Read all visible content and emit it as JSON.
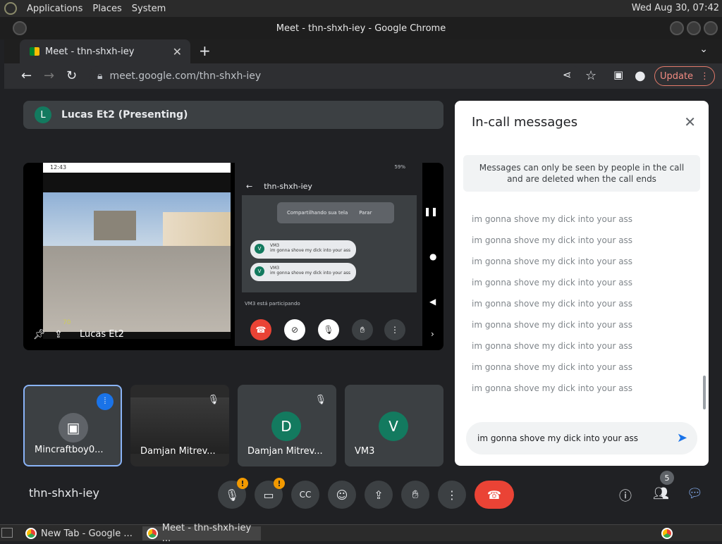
{
  "os": {
    "menu": [
      "Applications",
      "Places",
      "System"
    ],
    "clock": "Wed Aug 30, 07:42"
  },
  "window": {
    "title": "Meet - thn-shxh-iey - Google Chrome"
  },
  "tab": {
    "label": "Meet - thn-shxh-iey"
  },
  "nav": {
    "url": "meet.google.com/thn-shxh-iey",
    "update_label": "Update"
  },
  "presenting": {
    "initial": "L",
    "label": "Lucas Et2 (Presenting)"
  },
  "main_video": {
    "presenter": "Lucas Et2",
    "left_status": "12:43",
    "hud_value": "70",
    "right_status": "59%",
    "screen_header": "thn-shxh-iey",
    "toast_text": "Compartilhando sua tela",
    "toast_action": "Parar",
    "inner_messages": [
      {
        "initial": "V",
        "sender": "VM3",
        "text": "im gonna shove my dick into your ass"
      },
      {
        "initial": "V",
        "sender": "VM3",
        "text": "im gonna shove my dick into your ass"
      }
    ],
    "join_text": "VM3 está participando"
  },
  "tiles": [
    {
      "name": "Mincraftboy0...",
      "type": "image"
    },
    {
      "name": "Damjan Mitrev...",
      "type": "screen"
    },
    {
      "name": "Damjan Mitrev...",
      "initial": "D",
      "color": "#137a5f"
    },
    {
      "name": "VM3",
      "initial": "V",
      "color": "#137a5f"
    }
  ],
  "meeting_code": "thn-shxh-iey",
  "people_count": "5",
  "chat": {
    "title": "In-call messages",
    "notice": "Messages can only be seen by people in the call and are deleted when the call ends",
    "messages": [
      "im gonna shove my dick into your ass",
      "im gonna shove my dick into your ass",
      "im gonna shove my dick into your ass",
      "im gonna shove my dick into your ass",
      "im gonna shove my dick into your ass",
      "im gonna shove my dick into your ass",
      "im gonna shove my dick into your ass",
      "im gonna shove my dick into your ass",
      "im gonna shove my dick into your ass"
    ],
    "input_value": "im gonna shove my dick into your ass"
  },
  "taskbar": {
    "items": [
      "New Tab - Google ...",
      "Meet - thn-shxh-iey ..."
    ]
  },
  "colors": {
    "accent": "#1a73e8",
    "end_call": "#ea4335",
    "warning": "#f29900"
  }
}
